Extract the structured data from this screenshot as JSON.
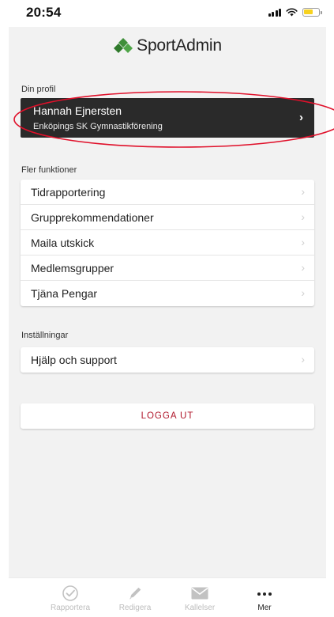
{
  "status_bar": {
    "time": "20:54",
    "battery_color": "#f7d21f"
  },
  "app": {
    "logo_text": "SportAdmin",
    "logo_color": "#3f8f3a"
  },
  "profile": {
    "section_label": "Din profil",
    "name": "Hannah Ejnersten",
    "club": "Enköpings SK Gymnastikförening",
    "chevron_icon": "chevron-right-icon",
    "highlight_color": "#e0102a"
  },
  "functions": {
    "section_label": "Fler funktioner",
    "items": [
      {
        "label": "Tidrapportering"
      },
      {
        "label": "Grupprekommendationer"
      },
      {
        "label": "Maila utskick"
      },
      {
        "label": "Medlemsgrupper"
      },
      {
        "label": "Tjäna Pengar"
      }
    ]
  },
  "settings": {
    "section_label": "Inställningar",
    "items": [
      {
        "label": "Hjälp och support"
      }
    ]
  },
  "logout": {
    "label": "LOGGA UT",
    "color": "#b0172b"
  },
  "tabbar": {
    "tabs": [
      {
        "label": "Rapportera",
        "icon": "check-circle-icon",
        "active": false
      },
      {
        "label": "Redigera",
        "icon": "pencil-icon",
        "active": false
      },
      {
        "label": "Kallelser",
        "icon": "envelope-icon",
        "active": false
      },
      {
        "label": "Mer",
        "icon": "more-dots-icon",
        "active": true
      }
    ]
  }
}
